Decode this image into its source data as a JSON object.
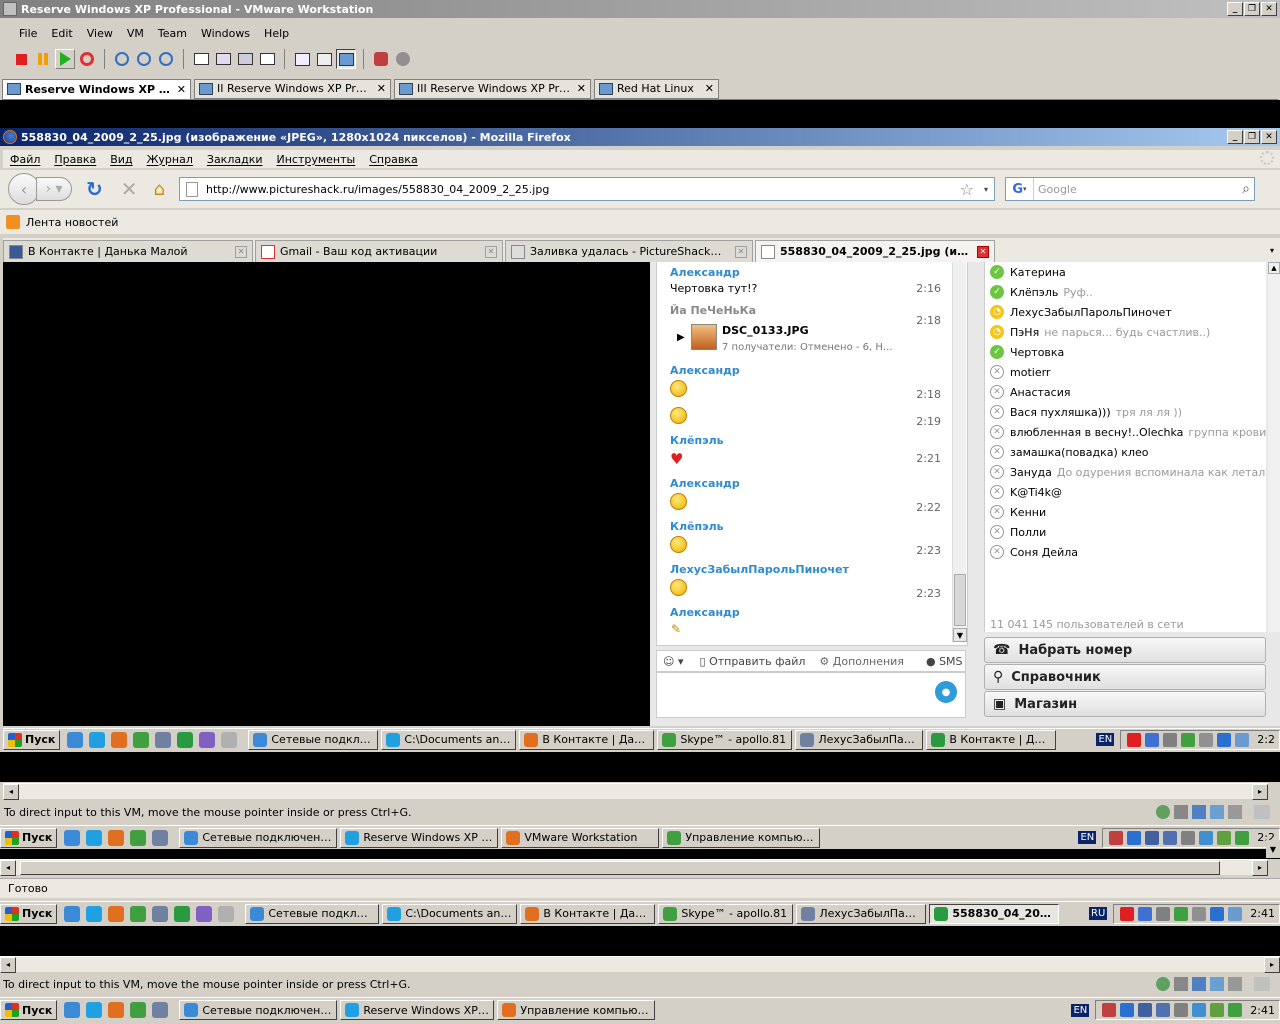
{
  "vmware": {
    "title": "Reserve Windows XP Professional - VMware Workstation",
    "menu": [
      "File",
      "Edit",
      "View",
      "VM",
      "Team",
      "Windows",
      "Help"
    ],
    "tabs": [
      {
        "label": "Reserve Windows XP Prof...",
        "active": true
      },
      {
        "label": "II Reserve Windows XP Profes...",
        "active": false
      },
      {
        "label": "III Reserve Windows XP Profe...",
        "active": false
      },
      {
        "label": "Red Hat Linux",
        "active": false
      }
    ],
    "status_hint": "To direct input to this VM, move the mouse pointer inside or press Ctrl+G."
  },
  "firefox": {
    "title": "558830_04_2009_2_25.jpg (изображение «JPEG», 1280x1024 пикселов) - Mozilla Firefox",
    "menu": [
      "Файл",
      "Правка",
      "Вид",
      "Журнал",
      "Закладки",
      "Инструменты",
      "Справка"
    ],
    "url": "http://www.pictureshack.ru/images/558830_04_2009_2_25.jpg",
    "search_placeholder": "Google",
    "bookmark": "Лента новостей",
    "tabs": [
      {
        "label": "В Контакте | Данька Малой",
        "active": false
      },
      {
        "label": "Gmail - Ваш код активации",
        "active": false
      },
      {
        "label": "Заливка удалась - PictureShack® Хос...",
        "active": false
      },
      {
        "label": "558830_04_2009_2_25.jpg (изо...",
        "active": true
      }
    ],
    "status": "Готово"
  },
  "chat": {
    "messages": [
      {
        "name": "Александр",
        "text": "Чертовка тут!?",
        "time": "2:16"
      },
      {
        "name": "Йа ПеЧеНьКа",
        "file": "DSC_0133.JPG",
        "file_info": "7 получатели: Отменено - 6, Н...",
        "time": "2:18"
      },
      {
        "name": "Александр",
        "smileys": [
          {
            "time": "2:18"
          },
          {
            "time": "2:19"
          }
        ]
      },
      {
        "name": "Клёпэль",
        "heart": true,
        "time": "2:21"
      },
      {
        "name": "Александр",
        "smileys": [
          {
            "time": "2:22"
          }
        ]
      },
      {
        "name": "Клёпэль",
        "smileys": [
          {
            "time": "2:23"
          }
        ]
      },
      {
        "name": "ЛехусЗабылПарольПиночет",
        "smileys": [
          {
            "time": "2:23"
          }
        ]
      },
      {
        "name": "Александр",
        "pencil": true
      }
    ],
    "toolbar": {
      "send_file": "Отправить файл",
      "addons": "Дополнения",
      "sms": "SMS"
    }
  },
  "contacts": {
    "list": [
      {
        "name": "Катерина",
        "status": "on",
        "mood": ""
      },
      {
        "name": "Клёпэль",
        "status": "on",
        "mood": "Руф.."
      },
      {
        "name": "ЛехусЗабылПарольПиночет",
        "status": "away",
        "mood": ""
      },
      {
        "name": "ПэНя",
        "status": "away",
        "mood": "не парься... будь счастлив..)"
      },
      {
        "name": "Чертовка",
        "status": "on",
        "mood": ""
      },
      {
        "name": "motierr",
        "status": "off",
        "mood": ""
      },
      {
        "name": "Анастасия",
        "status": "off",
        "mood": ""
      },
      {
        "name": "Вася пухляшка)))",
        "status": "off",
        "mood": "тря ля ля ))"
      },
      {
        "name": "влюбленная в весну!..Olechka",
        "status": "off",
        "mood": "группа крови - п..."
      },
      {
        "name": "замашка(повадка) клео",
        "status": "off",
        "mood": ""
      },
      {
        "name": "Зануда",
        "status": "off",
        "mood": "До одурения вспоминала как летала"
      },
      {
        "name": "K@Ti4k@",
        "status": "off",
        "mood": ""
      },
      {
        "name": "Кенни",
        "status": "off",
        "mood": ""
      },
      {
        "name": "Полли",
        "status": "off",
        "mood": ""
      },
      {
        "name": "Соня Дейла",
        "status": "off",
        "mood": ""
      }
    ],
    "online_count": "11 041 145 пользователей в сети",
    "buttons": [
      "Набрать номер",
      "Справочник",
      "Магазин"
    ]
  },
  "taskbar_inner": {
    "start": "Пуск",
    "items": [
      "Сетевые подклю...",
      "C:\\Documents and ...",
      "В Контакте | Дан...",
      "Skype™ - apollo.81",
      "ЛехусЗабылПарол...",
      "В Контакте | Дань..."
    ],
    "lang": "EN",
    "clock": "2:2"
  },
  "taskbar_mid": {
    "start": "Пуск",
    "items": [
      "Сетевые подключения",
      "Reserve Windows XP Pro...",
      "VMware Workstation",
      "Управление компьюте..."
    ],
    "lang": "EN",
    "clock": "2:2"
  },
  "taskbar_outer_vm": {
    "start": "Пуск",
    "items": [
      "Сетевые подклю...",
      "C:\\Documents and ...",
      "В Контакте | Дан...",
      "Skype™ - apollo.81",
      "ЛехусЗабылПарол...",
      "558830_04_200..."
    ],
    "lang": "RU",
    "clock": "2:41"
  },
  "taskbar_host": {
    "start": "Пуск",
    "items": [
      "Сетевые подключения",
      "Reserve Windows XP Pro...",
      "Управление компьюте..."
    ],
    "lang": "EN",
    "clock": "2:41"
  },
  "colors": {
    "xp_title": "#0a246a",
    "xp_title_end": "#a6caf0",
    "vm_title": "#808080",
    "skype_blue": "#2e8bd0"
  }
}
